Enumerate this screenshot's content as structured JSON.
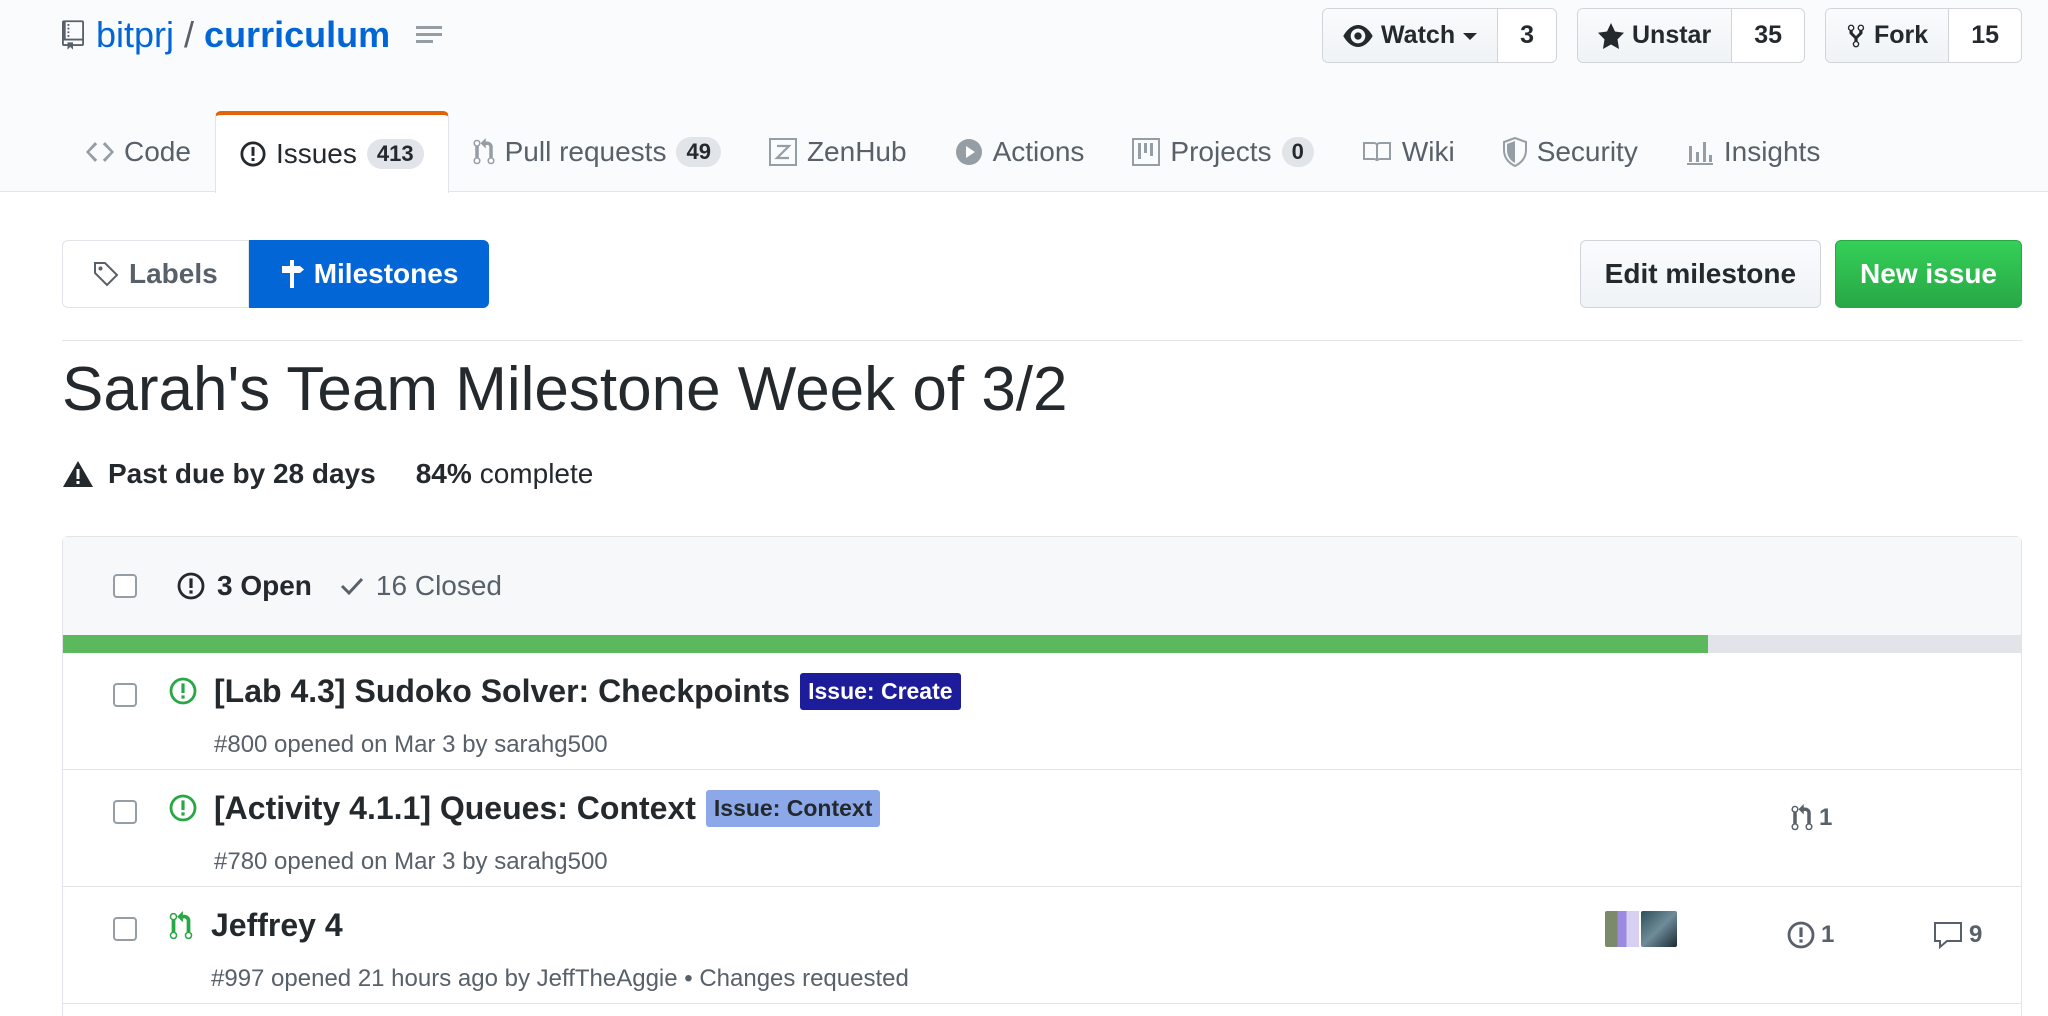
{
  "repo": {
    "owner": "bitprj",
    "separator": "/",
    "name": "curriculum"
  },
  "head_actions": {
    "watch": {
      "label": "Watch",
      "count": "3"
    },
    "star": {
      "label": "Unstar",
      "count": "35"
    },
    "fork": {
      "label": "Fork",
      "count": "15"
    }
  },
  "tabs": [
    {
      "label": "Code",
      "icon": "code-icon"
    },
    {
      "label": "Issues",
      "icon": "issue-opened-icon",
      "count": "413",
      "selected": true
    },
    {
      "label": "Pull requests",
      "icon": "git-pull-request-icon",
      "count": "49"
    },
    {
      "label": "ZenHub",
      "icon": "zenhub-icon"
    },
    {
      "label": "Actions",
      "icon": "play-icon"
    },
    {
      "label": "Projects",
      "icon": "project-icon",
      "count": "0"
    },
    {
      "label": "Wiki",
      "icon": "book-icon"
    },
    {
      "label": "Security",
      "icon": "shield-icon"
    },
    {
      "label": "Insights",
      "icon": "graph-icon"
    }
  ],
  "subnav": {
    "labels": "Labels",
    "milestones": "Milestones"
  },
  "buttons": {
    "edit_milestone": "Edit milestone",
    "new_issue": "New issue"
  },
  "milestone": {
    "title": "Sarah's Team Milestone Week of 3/2",
    "due": "Past due by 28 days",
    "percent": "84%",
    "percent_label": "complete",
    "progress": 0.84
  },
  "states": {
    "open": "3 Open",
    "closed": "16 Closed"
  },
  "issues": [
    {
      "title": "[Lab 4.3] Sudoko Solver: Checkpoints",
      "label": "Issue: Create",
      "meta": "#800 opened on Mar 3 by sarahg500",
      "type": "issue-opened-icon"
    },
    {
      "title": "[Activity 4.1.1] Queues: Context",
      "label": "Issue: Context",
      "meta": "#780 opened on Mar 3 by sarahg500",
      "linked_prs": "1",
      "type": "issue-opened-icon"
    },
    {
      "title": "Jeffrey 4",
      "meta": "#997 opened 21 hours ago by JeffTheAggie • Changes requested",
      "linked_issues": "1",
      "comments": "9",
      "type": "git-pull-request-icon"
    }
  ],
  "colors": {
    "link": "#0366d6",
    "tab_accent": "#e36209",
    "progress": "#5cb85c",
    "open_green": "#28a745",
    "label_create": "#1d1d9b",
    "label_context": "#8ca8e8",
    "primary_button": "#28a745"
  }
}
